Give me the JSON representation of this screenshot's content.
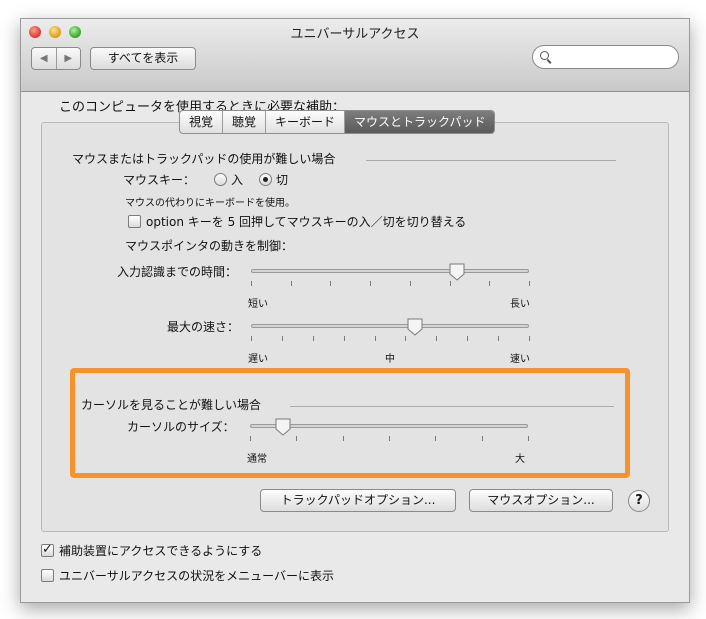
{
  "window": {
    "title": "ユニバーサルアクセス"
  },
  "toolbar": {
    "back_glyph": "◀",
    "forward_glyph": "▶",
    "show_all": "すべてを表示",
    "search_placeholder": ""
  },
  "heading": "このコンピュータを使用するときに必要な補助：",
  "tabs": [
    {
      "label": "視覚",
      "selected": false
    },
    {
      "label": "聴覚",
      "selected": false
    },
    {
      "label": "キーボード",
      "selected": false
    },
    {
      "label": "マウスとトラックパッド",
      "selected": true
    }
  ],
  "mouse_section": {
    "title": "マウスまたはトラックパッドの使用が難しい場合",
    "mouse_keys_label": "マウスキー：",
    "radio_on": "入",
    "radio_off": "切",
    "mouse_keys_value": "切",
    "note": "マウスの代わりにキーボードを使用。",
    "option_check": "option キーを 5 回押してマウスキーの入／切を切り替える",
    "option_checked": false,
    "control_label": "マウスポインタの動きを制御：",
    "delay": {
      "label": "入力認識までの時間：",
      "min": "短い",
      "max": "長い",
      "value": 0.74
    },
    "speed": {
      "label": "最大の速さ：",
      "min": "遅い",
      "mid": "中",
      "max": "速い",
      "value": 0.59
    }
  },
  "cursor_section": {
    "title": "カーソルを見ることが難しい場合",
    "size_label": "カーソルのサイズ：",
    "min": "通常",
    "max": "大",
    "value": 0.12
  },
  "buttons": {
    "trackpad": "トラックパッドオプション...",
    "mouse": "マウスオプション...",
    "help": "?"
  },
  "bottom": {
    "assistive": {
      "label": "補助装置にアクセスできるようにする",
      "checked": true
    },
    "menubar": {
      "label": "ユニバーサルアクセスの状況をメニューバーに表示",
      "checked": false
    }
  },
  "colors": {
    "highlight": "#f7932c",
    "selected_tab": "#666666"
  }
}
